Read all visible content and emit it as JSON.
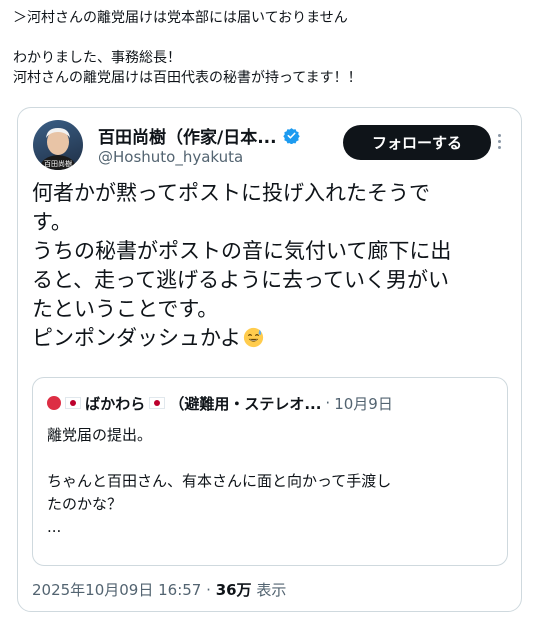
{
  "intro": {
    "lines": [
      "＞河村さんの離党届けは党本部には届いておりません",
      "",
      "わかりました、事務総長！",
      "河村さんの離党届けは百田代表の秘書が持ってます！！"
    ]
  },
  "tweet": {
    "author_name": "百田尚樹（作家/日本...",
    "handle": "@Hoshuto_hyakuta",
    "follow_label": "フォローする",
    "avatar_text": "百田尚樹",
    "text_lines": [
      "何者かが黙ってポストに投げ入れたそうで",
      "す。",
      "うちの秘書がポストの音に気付いて廊下に出",
      "ると、走って逃げるように去っていく男がい",
      "たということです。",
      "ピンポンダッシュかよ"
    ],
    "emoji_icon": "sweat-smile-emoji",
    "timestamp": "2025年10月09日 16:57",
    "separator": "·",
    "views_count": "36万",
    "views_label": "表示"
  },
  "quote": {
    "author_name": "ばかわら",
    "author_suffix": "（避難用・ステレオ...",
    "separator": "·",
    "date": "10月9日",
    "body_lines": [
      "離党届の提出。",
      "",
      "ちゃんと百田さん、有本さんに面と向かって手渡し",
      "たのかな？",
      "..."
    ]
  },
  "colors": {
    "text": "#0f1419",
    "secondary": "#536471",
    "border": "#cfd9de",
    "verified": "#1d9bf0",
    "follow_bg": "#0f1419"
  }
}
